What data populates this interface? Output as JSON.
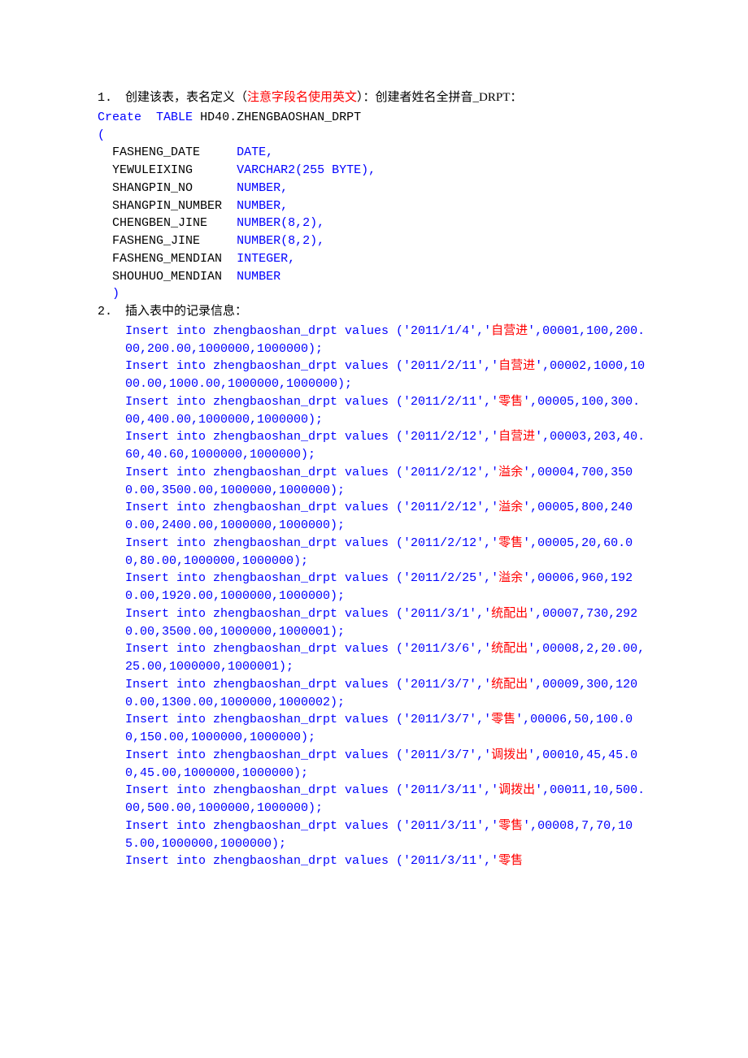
{
  "headings": {
    "h1_num": "1.",
    "h1_part1": "创建该表，表名定义（",
    "h1_red": "注意字段名使用英文",
    "h1_part2": "）：创建者姓名全拼音_DRPT：",
    "h2_num": "2.",
    "h2_text": "插入表中的记录信息："
  },
  "create": {
    "kw_create": "Create",
    "kw_table": "TABLE",
    "tablename": "HD40.ZHENGBAOSHAN_DRPT",
    "open": "(",
    "close": ")",
    "cols": [
      {
        "name": "FASHENG_DATE",
        "pad": "     ",
        "type": "DATE,",
        "extra": ""
      },
      {
        "name": "YEWULEIXING",
        "pad": "      ",
        "type": "VARCHAR2",
        "extra": "(255 BYTE),"
      },
      {
        "name": "SHANGPIN_NO",
        "pad": "      ",
        "type": "NUMBER,",
        "extra": ""
      },
      {
        "name": "SHANGPIN_NUMBER",
        "pad": "  ",
        "type": "NUMBER,",
        "extra": ""
      },
      {
        "name": "CHENGBEN_JINE",
        "pad": "    ",
        "type": "NUMBER",
        "extra": "(8,2),"
      },
      {
        "name": "FASHENG_JINE",
        "pad": "     ",
        "type": "NUMBER",
        "extra": "(8,2),"
      },
      {
        "name": "FASHENG_MENDIAN",
        "pad": "  ",
        "type": "INTEGER,",
        "extra": ""
      },
      {
        "name": "SHOUHUO_MENDIAN",
        "pad": "  ",
        "type": "NUMBER",
        "extra": ""
      }
    ]
  },
  "inserts": [
    {
      "sql_part": "Insert into zhengbaoshan_drpt values ('2011/1/4','",
      "red": "自营进",
      "tail": "',00001,100,200.00,200.00,1000000,1000000);"
    },
    {
      "sql_part": "Insert into zhengbaoshan_drpt values ('2011/2/11','",
      "red": "自营进",
      "tail": "',00002,1000,1000.00,1000.00,1000000,1000000);"
    },
    {
      "sql_part": "Insert into zhengbaoshan_drpt values ('2011/2/11','",
      "red": "零售",
      "tail": "',00005,100,300.00,400.00,1000000,1000000);"
    },
    {
      "sql_part": "Insert into zhengbaoshan_drpt values ('2011/2/12','",
      "red": "自营进",
      "tail": "',00003,203,40.60,40.60,1000000,1000000);"
    },
    {
      "sql_part": "Insert into zhengbaoshan_drpt values ('2011/2/12','",
      "red": "溢余",
      "tail": "',00004,700,3500.00,3500.00,1000000,1000000);"
    },
    {
      "sql_part": "Insert into zhengbaoshan_drpt values ('2011/2/12','",
      "red": "溢余",
      "tail": "',00005,800,2400.00,2400.00,1000000,1000000);"
    },
    {
      "sql_part": "Insert into zhengbaoshan_drpt values ('2011/2/12','",
      "red": "零售",
      "tail": "',00005,20,60.00,80.00,1000000,1000000);"
    },
    {
      "sql_part": "Insert into zhengbaoshan_drpt values ('2011/2/25','",
      "red": "溢余",
      "tail": "',00006,960,1920.00,1920.00,1000000,1000000);"
    },
    {
      "sql_part": "Insert into zhengbaoshan_drpt values ('2011/3/1','",
      "red": "统配出",
      "tail": "',00007,730,2920.00,3500.00,1000000,1000001);"
    },
    {
      "sql_part": "Insert into zhengbaoshan_drpt values ('2011/3/6','",
      "red": "统配出",
      "tail": "',00008,2,20.00,25.00,1000000,1000001);"
    },
    {
      "sql_part": "Insert into zhengbaoshan_drpt values ('2011/3/7','",
      "red": "统配出",
      "tail": "',00009,300,1200.00,1300.00,1000000,1000002);"
    },
    {
      "sql_part": "Insert into zhengbaoshan_drpt values ('2011/3/7','",
      "red": "零售",
      "tail": "',00006,50,100.00,150.00,1000000,1000000);"
    },
    {
      "sql_part": "Insert into zhengbaoshan_drpt values ('2011/3/7','",
      "red": "调拨出",
      "tail": "',00010,45,45.00,45.00,1000000,1000000);"
    },
    {
      "sql_part": "Insert into zhengbaoshan_drpt values ('2011/3/11','",
      "red": "调拨出",
      "tail": "',00011,10,500.00,500.00,1000000,1000000);"
    },
    {
      "sql_part": "Insert into zhengbaoshan_drpt values ('2011/3/11','",
      "red": "零售",
      "tail": "',00008,7,70,105.00,1000000,1000000);"
    },
    {
      "sql_part": "Insert into zhengbaoshan_drpt values ('2011/3/11','",
      "red": "零售",
      "tail": ""
    }
  ]
}
